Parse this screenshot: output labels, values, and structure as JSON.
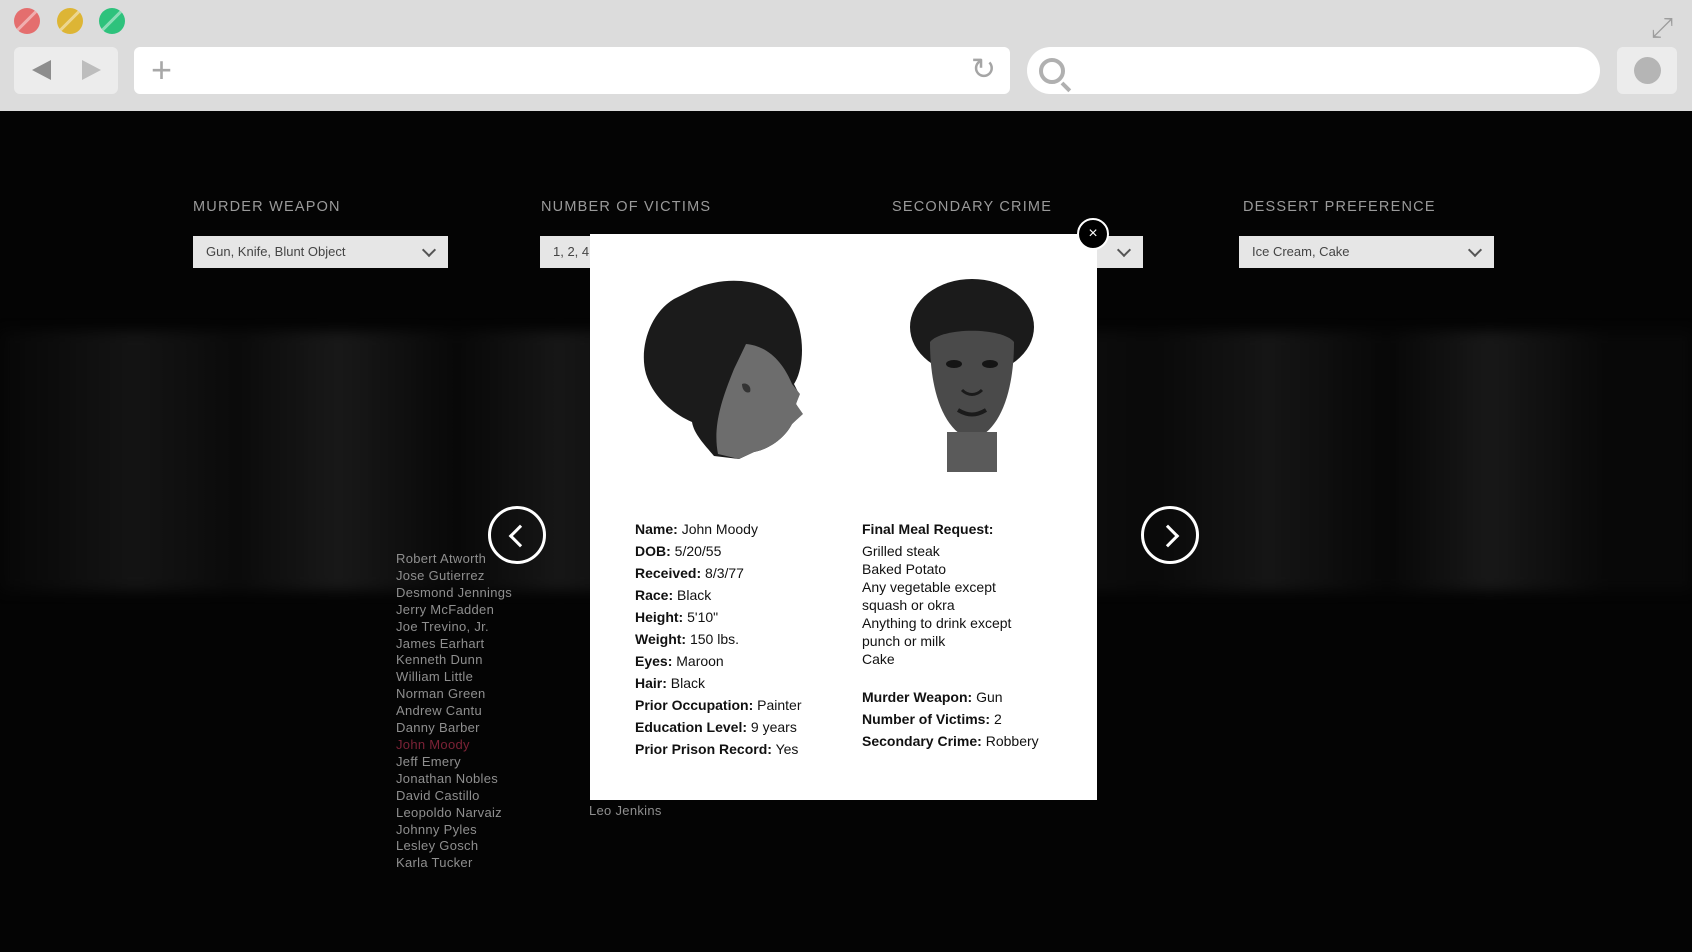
{
  "browser": {
    "url_value": "",
    "search_value": ""
  },
  "filters": [
    {
      "label": "MURDER WEAPON",
      "value": "Gun, Knife, Blunt Object"
    },
    {
      "label": "NUMBER OF VICTIMS",
      "value": "1, 2, 4"
    },
    {
      "label": "SECONDARY CRIME",
      "value": ""
    },
    {
      "label": "DESSERT PREFERENCE",
      "value": "Ice Cream, Cake"
    }
  ],
  "inmate_names": [
    "Robert Atworth",
    "Jose Gutierrez",
    "Desmond Jennings",
    "Jerry McFadden",
    "Joe Trevino, Jr.",
    "James Earhart",
    "Kenneth Dunn",
    "William Little",
    "Norman Green",
    "Andrew Cantu",
    "Danny Barber",
    "John Moody",
    "Jeff Emery",
    "Jonathan Nobles",
    "David Castillo",
    "Leopoldo Narvaiz",
    "Johnny Pyles",
    "Lesley Gosch",
    "Karla Tucker"
  ],
  "active_name": "John Moody",
  "inmate_names_col2": [
    "Leo Jenkins"
  ],
  "modal": {
    "close_label": "×",
    "details": [
      {
        "label": "Name:",
        "value": "John Moody"
      },
      {
        "label": "DOB:",
        "value": "5/20/55"
      },
      {
        "label": "Received:",
        "value": "8/3/77"
      },
      {
        "label": "Race:",
        "value": "Black"
      },
      {
        "label": "Height:",
        "value": "5'10\""
      },
      {
        "label": "Weight:",
        "value": "150 lbs."
      },
      {
        "label": "Eyes:",
        "value": "Maroon"
      },
      {
        "label": "Hair:",
        "value": "Black"
      },
      {
        "label": "Prior Occupation:",
        "value": "Painter"
      },
      {
        "label": "Education Level:",
        "value": "9 years"
      },
      {
        "label": "Prior Prison Record:",
        "value": "Yes"
      }
    ],
    "final_meal_label": "Final Meal Request:",
    "final_meal_lines": [
      "Grilled steak",
      "Baked Potato",
      "Any vegetable except",
      "squash or okra",
      "Anything to drink except",
      "punch or milk",
      "Cake"
    ],
    "crime": [
      {
        "label": "Murder Weapon:",
        "value": "Gun"
      },
      {
        "label": "Number of Victims:",
        "value": "2"
      },
      {
        "label": "Secondary Crime:",
        "value": "Robbery"
      }
    ]
  },
  "colors": {
    "active_name": "#7b2236",
    "background": "#040404"
  },
  "icons": {
    "close": "close-icon",
    "prev": "chevron-left-icon",
    "next": "chevron-right-icon"
  }
}
